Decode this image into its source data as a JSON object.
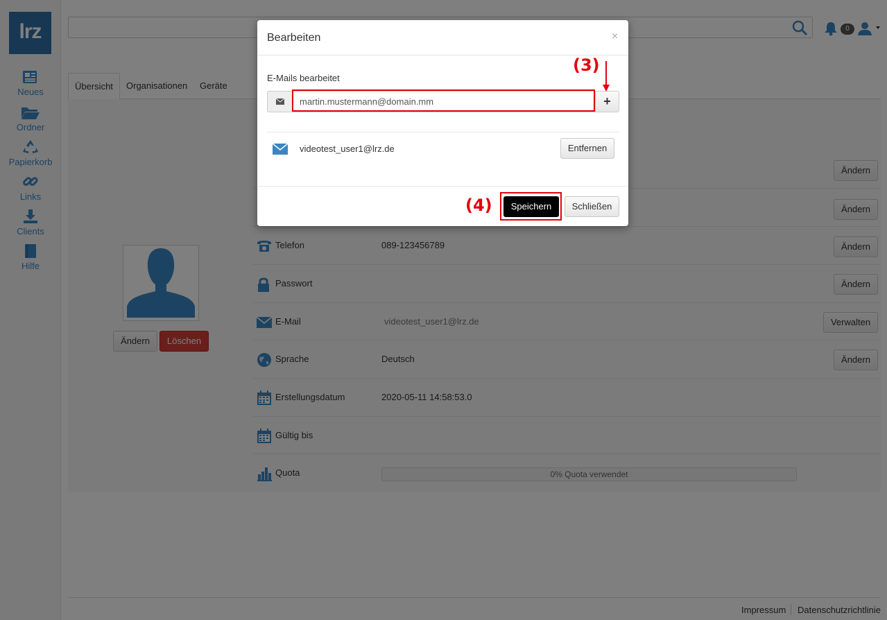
{
  "sidebar": {
    "logo": "lrz",
    "items": [
      {
        "label": "Neues",
        "icon": "news-icon"
      },
      {
        "label": "Ordner",
        "icon": "folder-icon"
      },
      {
        "label": "Papierkorb",
        "icon": "recycle-icon"
      },
      {
        "label": "Links",
        "icon": "link-icon"
      },
      {
        "label": "Clients",
        "icon": "download-icon"
      },
      {
        "label": "Hilfe",
        "icon": "book-icon"
      }
    ]
  },
  "topbar": {
    "notification_count": "0"
  },
  "tabs": [
    {
      "label": "Übersicht",
      "active": true
    },
    {
      "label": "Organisationen",
      "active": false
    },
    {
      "label": "Geräte",
      "active": false
    }
  ],
  "profile": {
    "change_label": "Ändern",
    "delete_label": "Löschen"
  },
  "rows": [
    {
      "label": "Telefon",
      "value": "089-123456789",
      "button": "Ändern",
      "icon": "phone-icon"
    },
    {
      "label": "Passwort",
      "value": "",
      "button": "Ändern",
      "icon": "lock-icon"
    },
    {
      "label": "E-Mail",
      "value": "videotest_user1@lrz.de",
      "button": "Verwalten",
      "icon": "mail-icon"
    },
    {
      "label": "Sprache",
      "value": "Deutsch",
      "button": "Ändern",
      "icon": "globe-icon"
    },
    {
      "label": "Erstellungsdatum",
      "value": "2020-05-11 14:58:53.0",
      "button": "",
      "icon": "calendar-icon"
    },
    {
      "label": "Gültig bis",
      "value": "",
      "button": "",
      "icon": "calendar-icon"
    },
    {
      "label": "Quota",
      "value": "0% Quota verwendet",
      "button": "",
      "icon": "bar-chart-icon",
      "quota_used_fraction": 0
    }
  ],
  "hidden_row_buttons": [
    "Ändern",
    "Ändern"
  ],
  "footer": {
    "impressum": "Impressum",
    "privacy": "Datenschutzrichtlinie"
  },
  "modal": {
    "title": "Bearbeiten",
    "close": "×",
    "section_label": "E-Mails bearbeitet",
    "input_value": "martin.mustermann@domain.mm",
    "add_button": "+",
    "emails": [
      {
        "address": "videotest_user1@lrz.de",
        "remove_label": "Entfernen"
      }
    ],
    "save_label": "Speichern",
    "close_label": "Schließen"
  },
  "annotations": {
    "step3": "(3)",
    "step4": "(4)"
  },
  "colors": {
    "accent": "#3a86c4",
    "danger": "#d43f3a",
    "highlight": "#e3000f",
    "logo": "#2f6ea7"
  }
}
